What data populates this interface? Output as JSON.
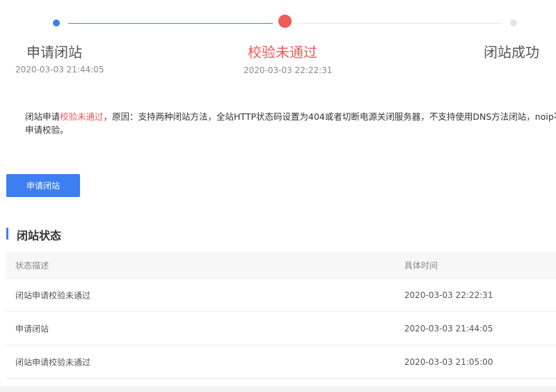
{
  "steps": [
    {
      "title": "申请闭站",
      "date": "2020-03-03 21:44:05",
      "state": "done"
    },
    {
      "title": "校验未通过",
      "date": "2020-03-03 22:22:31",
      "state": "failed"
    },
    {
      "title": "闭站成功",
      "date": "",
      "state": "pending"
    }
  ],
  "notice": {
    "prefix": "闭站申请",
    "highlight": "校验未通过",
    "rest_line1": "，原因：支持两种闭站方法，全站HTTP状态码设置为404或者切断电源关闭服务器，不支持使用DNS方法闭站，noip不",
    "line2": "申请校验。"
  },
  "apply_button": {
    "label": "申请闭站"
  },
  "section": {
    "title": "闭站状态"
  },
  "table": {
    "headers": {
      "desc": "状态描述",
      "time": "具体时间"
    },
    "rows": [
      {
        "desc": "闭站申请校验未通过",
        "time": "2020-03-03 22:22:31"
      },
      {
        "desc": "申请闭站",
        "time": "2020-03-03 21:44:05"
      },
      {
        "desc": "闭站申请校验未通过",
        "time": "2020-03-03 21:05:00"
      }
    ]
  },
  "colors": {
    "primary": "#3d7ff0",
    "error": "#f05a5a",
    "pending": "#e3e3e3"
  }
}
